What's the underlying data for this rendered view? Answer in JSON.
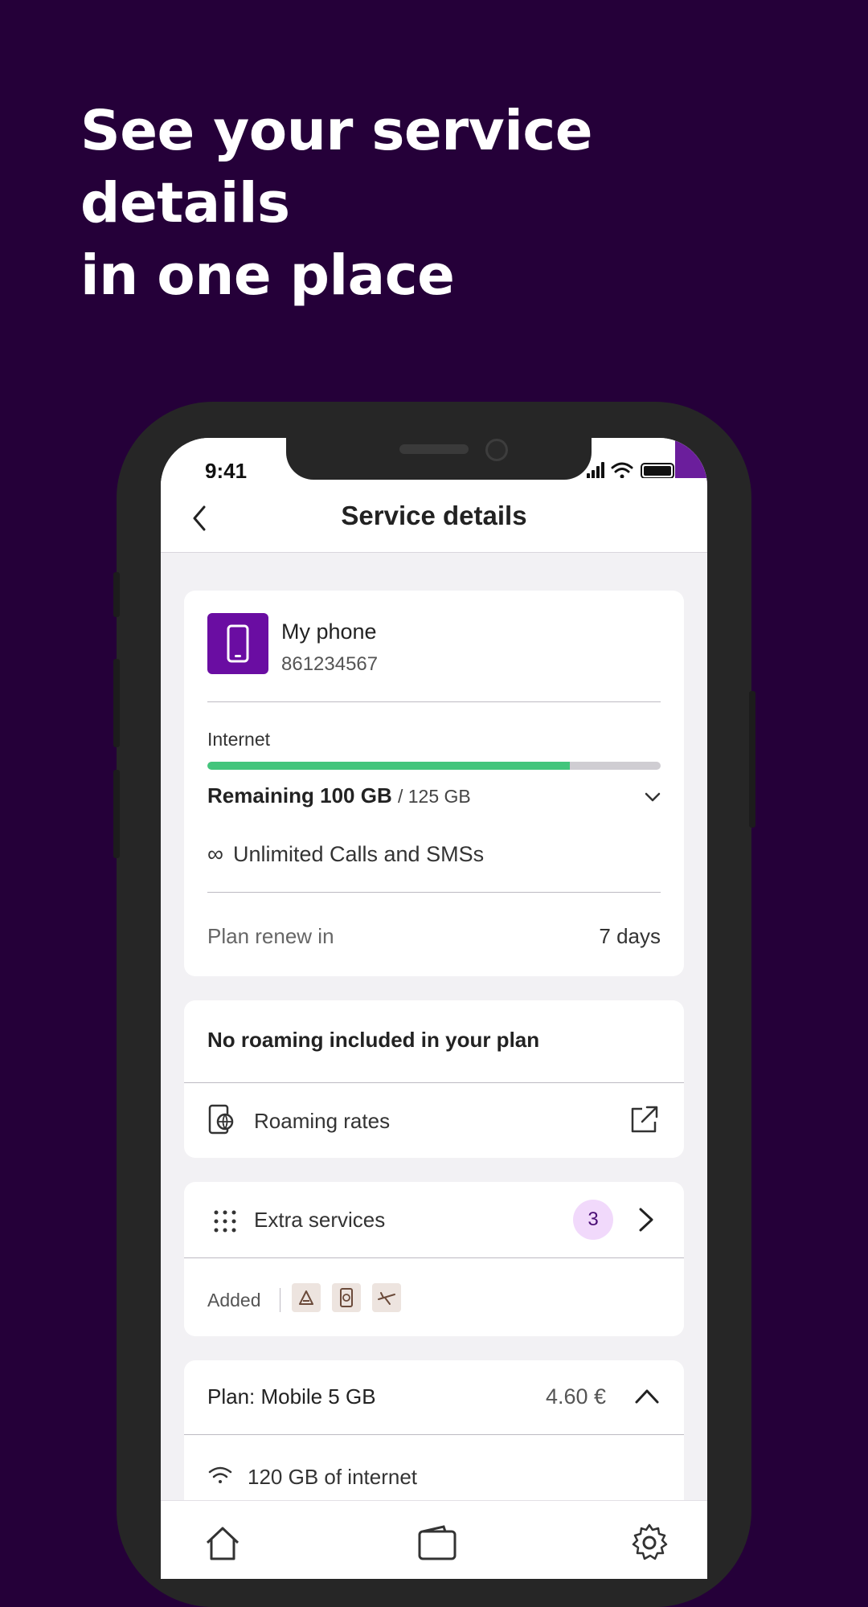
{
  "promo": {
    "headline_line1": "See your service details",
    "headline_line2": "in one place"
  },
  "status_bar": {
    "time": "9:41"
  },
  "appbar": {
    "title": "Service details",
    "back_icon": "chevron-left-icon"
  },
  "device_card": {
    "name": "My phone",
    "number": "861234567",
    "internet_label": "Internet",
    "remaining_label": "Remaining 100 GB",
    "total_label": "/ 125 GB",
    "usage_fraction": 0.8,
    "calls_icon": "infinity-icon",
    "calls_label": "Unlimited Calls and SMSs",
    "renew_label": "Plan renew in",
    "renew_value": "7 days"
  },
  "roaming_card": {
    "heading": "No roaming included in your plan",
    "link_label": "Roaming rates",
    "link_icon": "external-link-icon"
  },
  "extra_card": {
    "label": "Extra services",
    "count": "3",
    "added_label": "Added",
    "chips": [
      "tools-icon",
      "document-refresh-icon",
      "plane-icon"
    ]
  },
  "plan_card": {
    "title": "Plan: Mobile 5 GB",
    "price": "4.60 €",
    "feature": "120 GB of internet"
  },
  "bottom_nav": [
    "home-icon",
    "wallet-icon",
    "settings-icon"
  ],
  "colors": {
    "background": "#250039",
    "brand_purple": "#6a0da2",
    "progress_green": "#43c57c",
    "badge_bg": "#f1d9fb"
  }
}
